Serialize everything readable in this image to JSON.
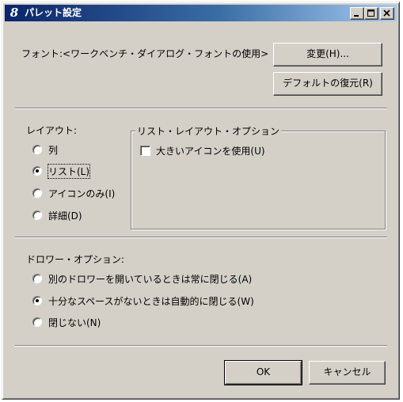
{
  "window": {
    "title": "パレット設定",
    "icon": "app-8-icon",
    "controls": {
      "minimize": "minimize-icon",
      "maximize": "maximize-icon",
      "close": "close-icon"
    }
  },
  "font": {
    "label": "フォント:<ワークベンチ・ダイアログ・フォントの使用>",
    "change_button": "変更(H)...",
    "reset_button": "デフォルトの復元(R)"
  },
  "layout": {
    "heading": "レイアウト:",
    "options": [
      {
        "label": "列",
        "selected": false
      },
      {
        "label": "リスト(L)",
        "selected": true
      },
      {
        "label": "アイコンのみ(I)",
        "selected": false
      },
      {
        "label": "詳細(D)",
        "selected": false
      }
    ]
  },
  "list_layout": {
    "group_title": "リスト・レイアウト・オプション",
    "large_icons_label": "大きいアイコンを使用(U)",
    "large_icons_checked": false
  },
  "drawer": {
    "heading": "ドロワー・オプション:",
    "options": [
      {
        "label": "別のドロワーを開いているときは常に閉じる(A)",
        "selected": false
      },
      {
        "label": "十分なスペースがないときは自動的に閉じる(W)",
        "selected": true
      },
      {
        "label": "閉じない(N)",
        "selected": false
      }
    ]
  },
  "footer": {
    "ok": "OK",
    "cancel": "キャンセル"
  },
  "colors": {
    "title_start": "#0a246a",
    "title_end": "#a6caf0",
    "face": "#d4d0c8"
  }
}
